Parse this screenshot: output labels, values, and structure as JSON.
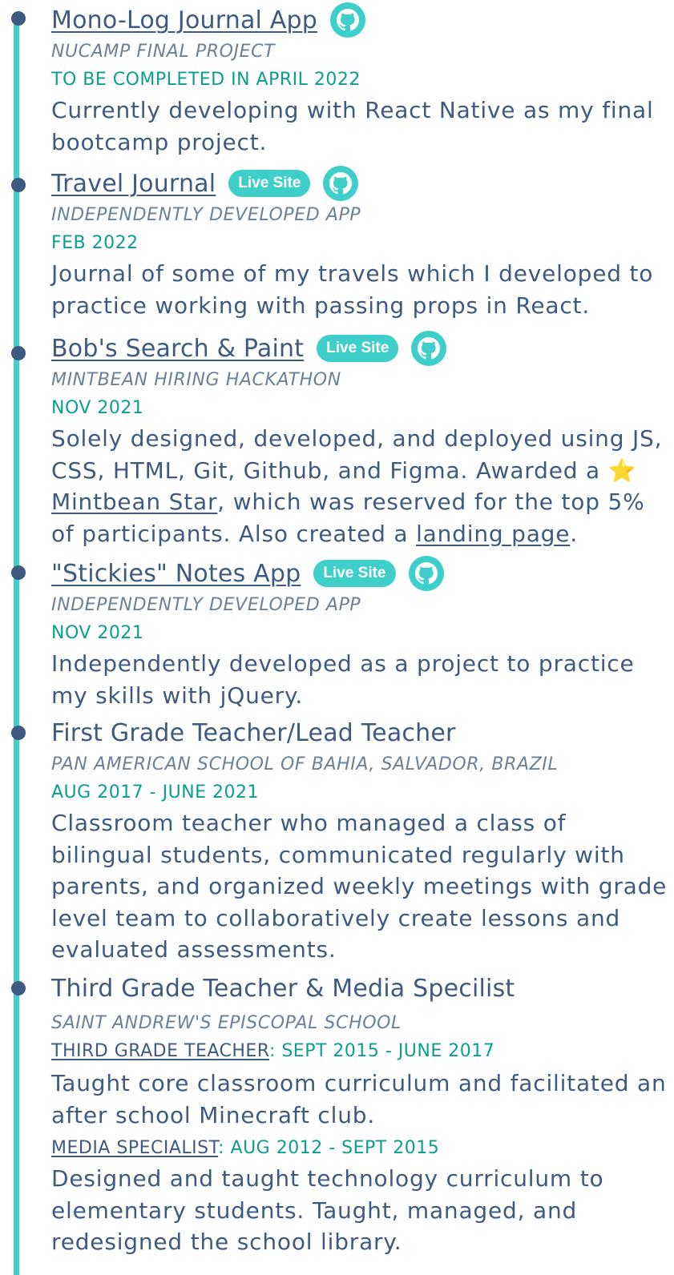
{
  "entries": [
    {
      "title": "Mono-Log Journal App",
      "org": "NUCAMP FINAL PROJECT",
      "date": "TO BE COMPLETED IN APRIL 2022",
      "desc": "Currently developing with React Native as my final bootcamp project."
    },
    {
      "title": "Travel Journal",
      "badge": "Live Site",
      "org": "INDEPENDENTLY DEVELOPED APP",
      "date": "FEB 2022",
      "desc": "Journal of some of my travels which I developed to practice working with passing props in React."
    },
    {
      "title": "Bob's Search & Paint",
      "badge": "Live Site",
      "org": "MINTBEAN HIRING HACKATHON",
      "date": "NOV 2021",
      "desc_part1": "Solely designed, developed, and deployed using JS, CSS, HTML, Git, Github, and Figma. Awarded a ⭐ ",
      "desc_link1": "Mintbean Star",
      "desc_part2": ", which was reserved for the top 5% of participants. Also created a ",
      "desc_link2": "landing page",
      "desc_part3": "."
    },
    {
      "title": "\"Stickies\" Notes App",
      "badge": "Live Site",
      "org": "INDEPENDENTLY DEVELOPED APP",
      "date": "NOV 2021",
      "desc": "Independently developed as a project to practice my skills with jQuery."
    },
    {
      "title": "First Grade Teacher/Lead Teacher",
      "org": "PAN AMERICAN SCHOOL OF BAHIA, SALVADOR, BRAZIL",
      "date": "AUG 2017 - JUNE 2021",
      "desc": "Classroom teacher who managed a class of bilingual students, communicated regularly with parents,  and organized weekly meetings with grade level team to collaboratively create lessons and evaluated assessments."
    },
    {
      "title": "Third Grade Teacher & Media Specilist",
      "org": "SAINT ANDREW'S EPISCOPAL SCHOOL",
      "role1": "THIRD GRADE TEACHER",
      "date1": ": SEPT 2015 - JUNE 2017",
      "desc1": "Taught core classroom curriculum and facilitated an after school Minecraft club.",
      "role2": "MEDIA SPECIALIST",
      "date2": ": AUG 2012 - SEPT 2015",
      "desc2": "Designed and taught technology curriculum to elementary students. Taught, managed, and redesigned the school library."
    }
  ],
  "colors": {
    "accent_teal": "#3fcfcb",
    "navy": "#3d5a80",
    "date_green": "#0b9e90"
  },
  "icons": {
    "repo": "github-icon"
  }
}
